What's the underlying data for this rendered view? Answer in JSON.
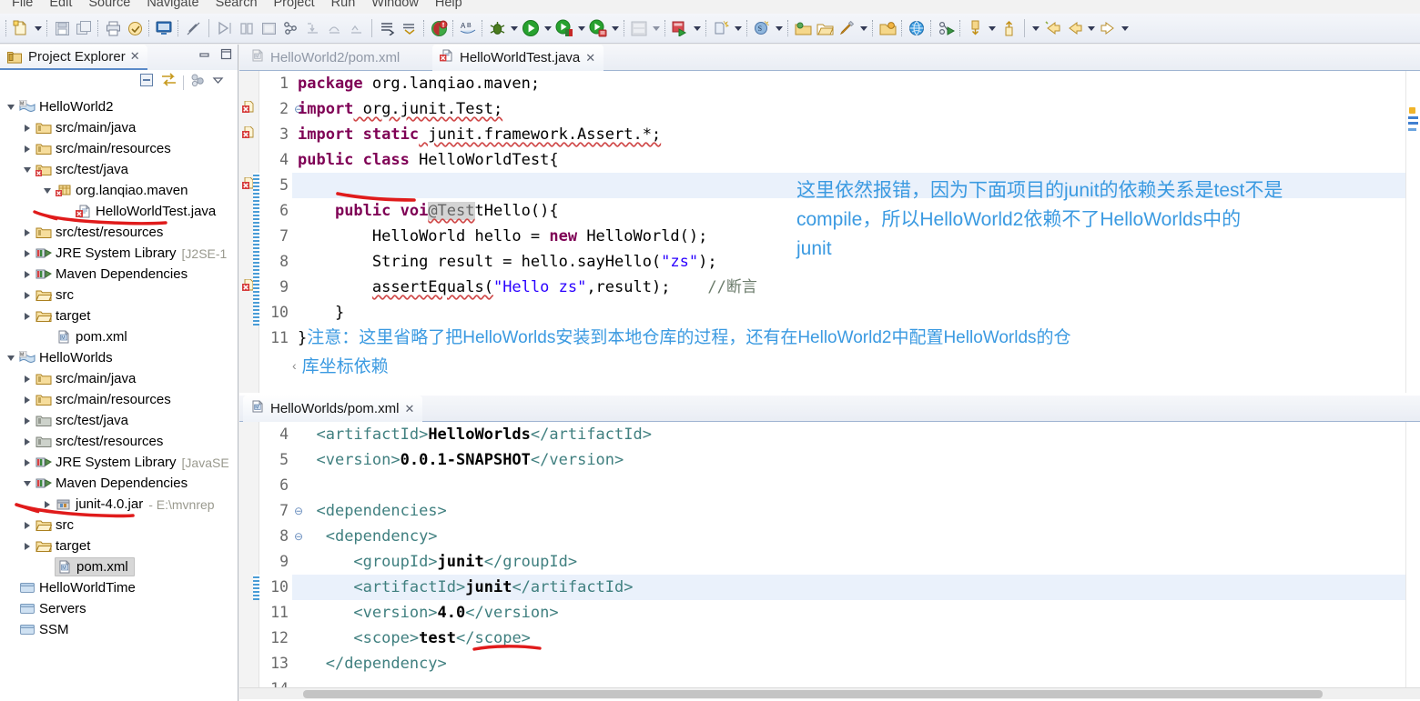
{
  "menu": {
    "items": [
      "File",
      "Edit",
      "Source",
      "Navigate",
      "Search",
      "Project",
      "Run",
      "Window",
      "Help"
    ]
  },
  "toolbar": {
    "icons": [
      "new-file-icon",
      "new-dropdown-arrow",
      "save-icon",
      "save-all-icon",
      "print-icon",
      "export-icon",
      "terminal-icon",
      "link-off-icon",
      "run-last-icon",
      "step-icon",
      "terminate-icon",
      "skip-breakpoints-icon",
      "step-into-icon",
      "step-over-icon",
      "step-return-icon",
      "next-annotation-icon",
      "previous-annotation-icon",
      "error-marker-icon",
      "spellcheck-icon",
      "debug-icon",
      "debug-dropdown-arrow",
      "run-icon",
      "run-dropdown-arrow",
      "run-external-icon",
      "run-external-dropdown-arrow",
      "coverage-icon",
      "coverage-dropdown-arrow",
      "server-icon",
      "server-dropdown-arrow",
      "run-server-icon",
      "run-server-dropdown-arrow",
      "new-java-project-icon",
      "new-java-dropdown-arrow",
      "new-class-icon",
      "new-class-dropdown-arrow",
      "open-type-icon",
      "open-task-icon",
      "search-icon",
      "search-dropdown-arrow",
      "open-resource-icon",
      "globe-icon",
      "profile-icon",
      "next-edit-icon",
      "next-edit-dropdown-arrow",
      "previous-edit-icon",
      "back-dropdown-arrow",
      "back-icon",
      "back-nav-icon",
      "forward-dropdown-arrow",
      "forward-icon",
      "forward-dropdown-arrow-2"
    ]
  },
  "project_explorer": {
    "title": "Project Explorer",
    "view_icons": [
      "collapse-all-icon",
      "link-with-editor-icon",
      "view-menu-icon",
      "view-menu-arrow-icon"
    ],
    "window_buttons": [
      "minimize-icon",
      "maximize-icon"
    ],
    "tree": [
      {
        "label": "HelloWorld2",
        "indent": 0,
        "twisty": "expanded",
        "icon": "maven-project-icon"
      },
      {
        "label": "src/main/java",
        "indent": 1,
        "twisty": "collapsed",
        "icon": "source-folder-icon"
      },
      {
        "label": "src/main/resources",
        "indent": 1,
        "twisty": "collapsed",
        "icon": "source-folder-icon"
      },
      {
        "label": "src/test/java",
        "indent": 1,
        "twisty": "expanded",
        "icon": "source-folder-error-icon"
      },
      {
        "label": "org.lanqiao.maven",
        "indent": 2,
        "twisty": "expanded",
        "icon": "package-error-icon"
      },
      {
        "label": "HelloWorldTest.java",
        "indent": 3,
        "twisty": "none",
        "icon": "java-file-error-icon",
        "annotated": true
      },
      {
        "label": "src/test/resources",
        "indent": 1,
        "twisty": "collapsed",
        "icon": "source-folder-icon"
      },
      {
        "label": "JRE System Library",
        "indent": 1,
        "twisty": "collapsed",
        "icon": "library-icon",
        "sub": "[J2SE-1"
      },
      {
        "label": "Maven Dependencies",
        "indent": 1,
        "twisty": "collapsed",
        "icon": "library-icon"
      },
      {
        "label": "src",
        "indent": 1,
        "twisty": "collapsed",
        "icon": "folder-src-icon"
      },
      {
        "label": "target",
        "indent": 1,
        "twisty": "collapsed",
        "icon": "folder-icon"
      },
      {
        "label": "pom.xml",
        "indent": 1,
        "twisty": "none",
        "icon": "maven-pom-icon"
      },
      {
        "label": "HelloWorlds",
        "indent": 0,
        "twisty": "expanded",
        "icon": "maven-project-icon"
      },
      {
        "label": "src/main/java",
        "indent": 1,
        "twisty": "collapsed",
        "icon": "source-folder-icon"
      },
      {
        "label": "src/main/resources",
        "indent": 1,
        "twisty": "collapsed",
        "icon": "source-folder-icon"
      },
      {
        "label": "src/test/java",
        "indent": 1,
        "twisty": "collapsed",
        "icon": "source-folder-gray-icon"
      },
      {
        "label": "src/test/resources",
        "indent": 1,
        "twisty": "collapsed",
        "icon": "source-folder-gray-icon"
      },
      {
        "label": "JRE System Library",
        "indent": 1,
        "twisty": "collapsed",
        "icon": "library-icon",
        "sub": "[JavaSE"
      },
      {
        "label": "Maven Dependencies",
        "indent": 1,
        "twisty": "expanded",
        "icon": "library-icon"
      },
      {
        "label": "junit-4.0.jar",
        "indent": 2,
        "twisty": "collapsed",
        "icon": "jar-icon",
        "sub": "- E:\\mvnrep",
        "annotated": true
      },
      {
        "label": "src",
        "indent": 1,
        "twisty": "collapsed",
        "icon": "folder-src-icon"
      },
      {
        "label": "target",
        "indent": 1,
        "twisty": "collapsed",
        "icon": "folder-icon"
      },
      {
        "label": "pom.xml",
        "indent": 1,
        "twisty": "none",
        "icon": "maven-pom-icon",
        "selected": true
      },
      {
        "label": "HelloWorldTime",
        "indent": 0,
        "twisty": "none",
        "icon": "closed-project-icon"
      },
      {
        "label": "Servers",
        "indent": 0,
        "twisty": "none",
        "icon": "closed-project-icon"
      },
      {
        "label": "SSM",
        "indent": 0,
        "twisty": "none",
        "icon": "closed-project-icon"
      }
    ]
  },
  "top_editor": {
    "tabs": [
      {
        "label": "HelloWorld2/pom.xml",
        "icon": "maven-pom-icon",
        "active": false,
        "closeable": false
      },
      {
        "label": "HelloWorldTest.java",
        "icon": "java-file-error-icon",
        "active": true,
        "closeable": true
      }
    ],
    "lines": [
      {
        "num": "1",
        "fold": "",
        "markers": [],
        "highlight": false,
        "changed": false
      },
      {
        "num": "2",
        "fold": "⊖",
        "markers": [
          "error"
        ],
        "highlight": false,
        "changed": false
      },
      {
        "num": "3",
        "fold": "",
        "markers": [
          "error"
        ],
        "highlight": false,
        "changed": false
      },
      {
        "num": "4",
        "fold": "",
        "markers": [],
        "highlight": false,
        "changed": false
      },
      {
        "num": "5",
        "fold": "⊖",
        "markers": [
          "error"
        ],
        "highlight": true,
        "changed": true
      },
      {
        "num": "6",
        "fold": "",
        "markers": [],
        "highlight": false,
        "changed": true
      },
      {
        "num": "7",
        "fold": "",
        "markers": [],
        "highlight": false,
        "changed": true
      },
      {
        "num": "8",
        "fold": "",
        "markers": [],
        "highlight": false,
        "changed": true
      },
      {
        "num": "9",
        "fold": "",
        "markers": [
          "error"
        ],
        "highlight": false,
        "changed": true
      },
      {
        "num": "10",
        "fold": "",
        "markers": [],
        "highlight": false,
        "changed": true
      },
      {
        "num": "11",
        "fold": "",
        "markers": [],
        "highlight": false,
        "changed": false
      }
    ],
    "code": {
      "l1_kw": "package",
      "l1_rest": " org.lanqiao.maven;",
      "l2_kw": "import",
      "l2_rest": " org.junit.Test;",
      "l3_kw": "import static",
      "l3_rest": " junit.framework.Assert.*;",
      "l4_kw1": "public class",
      "l4_rest": " HelloWorldTest{",
      "l5_anno": "@Test",
      "l6_kw": "public void",
      "l6_rest": " testHello(){",
      "l7_a": "HelloWorld hello = ",
      "l7_kw": "new",
      "l7_b": " HelloWorld();",
      "l8": "String result = hello.sayHello(",
      "l8_str": "\"zs\"",
      "l8_b": ");",
      "l9_a": "assertEquals(",
      "l9_str": "\"Hello zs\"",
      "l9_b": ",result);",
      "l9_cmt": "//断言",
      "l10": "}",
      "l11": "}"
    },
    "blue_annotation": "这里依然报错，因为下面项目的junit的依赖关系是test不是\ncompile，所以HelloWorld2依赖不了HelloWorlds中的\njunit",
    "line11_note": "注意：这里省略了把HelloWorlds安装到本地仓库的过程，还有在HelloWorld2中配置HelloWorlds的仓",
    "wrapped_note": "库坐标依赖"
  },
  "bottom_editor": {
    "tabs": [
      {
        "label": "HelloWorlds/pom.xml",
        "icon": "maven-pom-icon",
        "active": true,
        "closeable": true
      }
    ],
    "lines": [
      {
        "num": "4",
        "fold": "",
        "highlight": false,
        "changed": false
      },
      {
        "num": "5",
        "fold": "",
        "highlight": false,
        "changed": false
      },
      {
        "num": "6",
        "fold": "",
        "highlight": false,
        "changed": false
      },
      {
        "num": "7",
        "fold": "⊖",
        "highlight": false,
        "changed": false
      },
      {
        "num": "8",
        "fold": "⊖",
        "highlight": false,
        "changed": false
      },
      {
        "num": "9",
        "fold": "",
        "highlight": false,
        "changed": false
      },
      {
        "num": "10",
        "fold": "",
        "highlight": true,
        "changed": true
      },
      {
        "num": "11",
        "fold": "",
        "highlight": false,
        "changed": false
      },
      {
        "num": "12",
        "fold": "",
        "highlight": false,
        "changed": false
      },
      {
        "num": "13",
        "fold": "",
        "highlight": false,
        "changed": false
      },
      {
        "num": "14",
        "fold": "",
        "highlight": false,
        "changed": false
      }
    ],
    "code": {
      "l4_o": "<artifactId>",
      "l4_v": "HelloWorlds",
      "l4_c": "</artifactId>",
      "l5_o": "<version>",
      "l5_v": "0.0.1-SNAPSHOT",
      "l5_c": "</version>",
      "l7": "<dependencies>",
      "l8": "<dependency>",
      "l9_o": "<groupId>",
      "l9_v": "junit",
      "l9_c": "</groupId>",
      "l10_o": "<artifactId>",
      "l10_v": "junit",
      "l10_c": "</artifactId>",
      "l11_o": "<version>",
      "l11_v": "4.0",
      "l11_c": "</version>",
      "l12_o": "<scope>",
      "l12_v": "test",
      "l12_c": "</scope>",
      "l13": "</dependency>"
    }
  },
  "colors": {
    "keyword": "#7f0055",
    "string": "#2a00ff",
    "comment": "#6b7b6b",
    "xml_tag": "#3f7f7f",
    "annotation_blue": "#3b9ae1",
    "red_pen": "#e01b1b",
    "current_line": "#eaf1fb",
    "selection": "#d4d4d4"
  }
}
